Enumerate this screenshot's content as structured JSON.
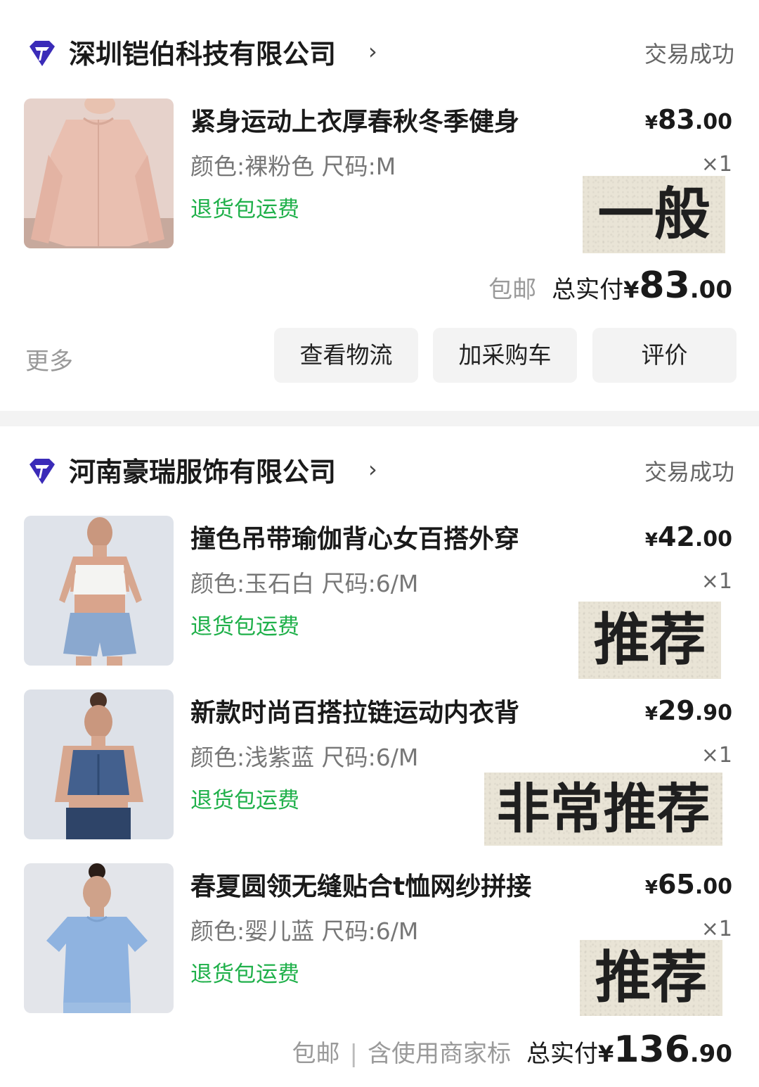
{
  "orders": [
    {
      "shop_name": "深圳铠伯科技有限公司",
      "status": "交易成功",
      "items": [
        {
          "title": "紧身运动上衣厚春秋冬季健身",
          "spec": "颜色:裸粉色 尺码:M",
          "tag": "退货包运费",
          "price_symbol": "¥",
          "price_int": "83",
          "price_dec": ".00",
          "qty": "×1",
          "sticker": "一般"
        }
      ],
      "shipping": "包邮",
      "total_label": "总实付",
      "total_symbol": "¥",
      "total_int": "83",
      "total_dec": ".00",
      "more": "更多",
      "actions": [
        "查看物流",
        "加采购车",
        "评价"
      ]
    },
    {
      "shop_name": "河南豪瑞服饰有限公司",
      "status": "交易成功",
      "items": [
        {
          "title": "撞色吊带瑜伽背心女百搭外穿",
          "spec": "颜色:玉石白 尺码:6/M",
          "tag": "退货包运费",
          "price_symbol": "¥",
          "price_int": "42",
          "price_dec": ".00",
          "qty": "×1",
          "sticker": "推荐"
        },
        {
          "title": "新款时尚百搭拉链运动内衣背",
          "spec": "颜色:浅紫蓝 尺码:6/M",
          "tag": "退货包运费",
          "price_symbol": "¥",
          "price_int": "29",
          "price_dec": ".90",
          "qty": "×1",
          "sticker": "非常推荐"
        },
        {
          "title": "春夏圆领无缝贴合t恤网纱拼接",
          "spec": "颜色:婴儿蓝 尺码:6/M",
          "tag": "退货包运费",
          "price_symbol": "¥",
          "price_int": "65",
          "price_dec": ".00",
          "qty": "×1",
          "sticker": "推荐"
        }
      ],
      "shipping": "包邮",
      "separator": "|",
      "merchant_note": "含使用商家标",
      "total_label": "总实付",
      "total_symbol": "¥",
      "total_int": "136",
      "total_dec": ".90"
    }
  ],
  "colors": {
    "accent_green": "#1fb04a",
    "logo_purple": "#3a2bb8",
    "sticker_bg": "#e9e4d6",
    "section_gap": "#f3f3f3"
  }
}
